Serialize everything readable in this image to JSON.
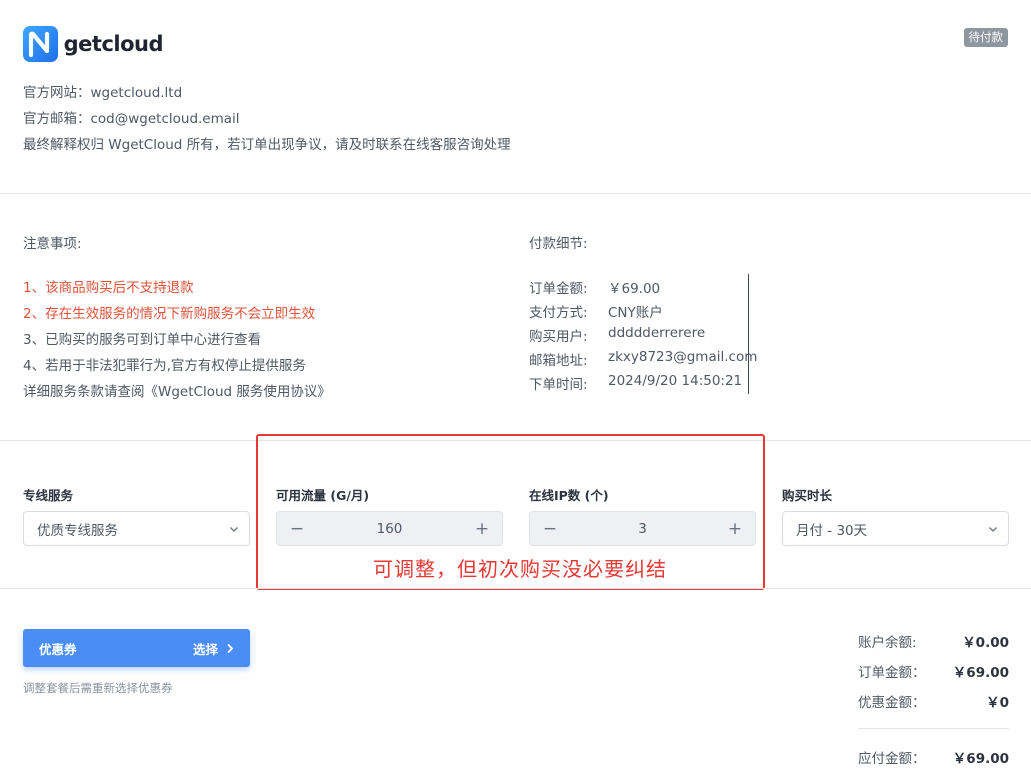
{
  "header": {
    "logo_text": "getcloud",
    "status_badge": "待付款",
    "website": "官方网站：wgetcloud.ltd",
    "email": "官方邮箱：cod@wgetcloud.email",
    "disclaimer": "最终解释权归 WgetCloud 所有，若订单出现争议，请及时联系在线客服咨询处理"
  },
  "notices": {
    "title": "注意事项:",
    "items": [
      {
        "text": "1、该商品购买后不支持退款",
        "color": "#e0533a"
      },
      {
        "text": "2、存在生效服务的情况下新购服务不会立即生效",
        "color": "#e0533a"
      },
      {
        "text": "3、已购买的服务可到订单中心进行查看",
        "color": "#4f5866"
      },
      {
        "text": "4、若用于非法犯罪行为,官方有权停止提供服务",
        "color": "#4f5866"
      },
      {
        "text": "详细服务条款请查阅《WgetCloud 服务使用协议》",
        "color": "#4f5866"
      }
    ]
  },
  "payment": {
    "title": "付款细节:",
    "rows": [
      {
        "label": "订单金额:",
        "value": "￥69.00"
      },
      {
        "label": "支付方式:",
        "value": "CNY账户"
      },
      {
        "label": "购买用户:",
        "value": "ddddderrerere"
      },
      {
        "label": "邮箱地址:",
        "value": "zkxy8723@gmail.com"
      },
      {
        "label": "下单时间:",
        "value": "2024/9/20 14:50:21"
      }
    ]
  },
  "controls": {
    "line_service": {
      "label": "专线服务",
      "selected": "优质专线服务"
    },
    "traffic": {
      "label": "可用流量 (G/月)",
      "value": "160"
    },
    "ip_count": {
      "label": "在线IP数 (个)",
      "value": "3"
    },
    "duration": {
      "label": "购买时长",
      "selected": "月付 - 30天"
    }
  },
  "annotation": "可调整，但初次购买没必要纠结",
  "coupon": {
    "label": "优惠券",
    "action": "选择",
    "hint": "调整套餐后需重新选择优惠券"
  },
  "totals": {
    "balance_label": "账户余额:",
    "balance_value": "￥0.00",
    "order_label": "订单金额：",
    "order_value": "￥69.00",
    "discount_label": "优惠金额：",
    "discount_value": "￥0",
    "payable_label": "应付金额：",
    "payable_value": "￥69.00"
  },
  "colors": {
    "accent": "#4a8df7",
    "warning_text": "#e0533a",
    "annotation": "#e53935"
  }
}
